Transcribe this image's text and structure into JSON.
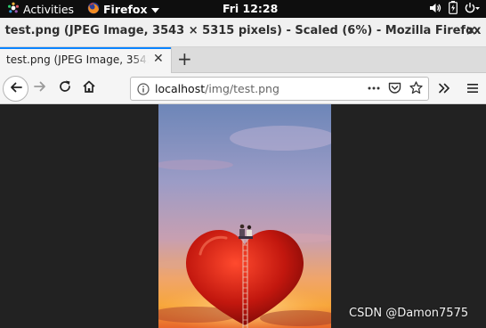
{
  "topbar": {
    "activities": "Activities",
    "app_menu": "Firefox",
    "clock": "Fri 12:28"
  },
  "window": {
    "title": "test.png (JPEG Image, 3543 × 5315 pixels) - Scaled (6%) - Mozilla Firefox"
  },
  "tabs": [
    {
      "label": "test.png (JPEG Image, 3543 × 5315 pixels) - Scaled (6%)"
    }
  ],
  "nav": {
    "url_host": "localhost",
    "url_path": "/img/test.png"
  },
  "watermark": "CSDN @Damon7575",
  "colors": {
    "accent": "#0a84ff",
    "topbar_bg": "#0e0e0e",
    "content_bg": "#222222"
  },
  "icons": [
    "activities-icon",
    "firefox-icon",
    "chevron-down-icon",
    "volume-icon",
    "battery-icon",
    "power-icon",
    "close-icon",
    "plus-icon",
    "back-arrow-icon",
    "forward-arrow-icon",
    "reload-icon",
    "home-icon",
    "info-icon",
    "more-dots-icon",
    "pocket-icon",
    "bookmark-star-icon",
    "overflow-icon",
    "hamburger-menu-icon"
  ]
}
